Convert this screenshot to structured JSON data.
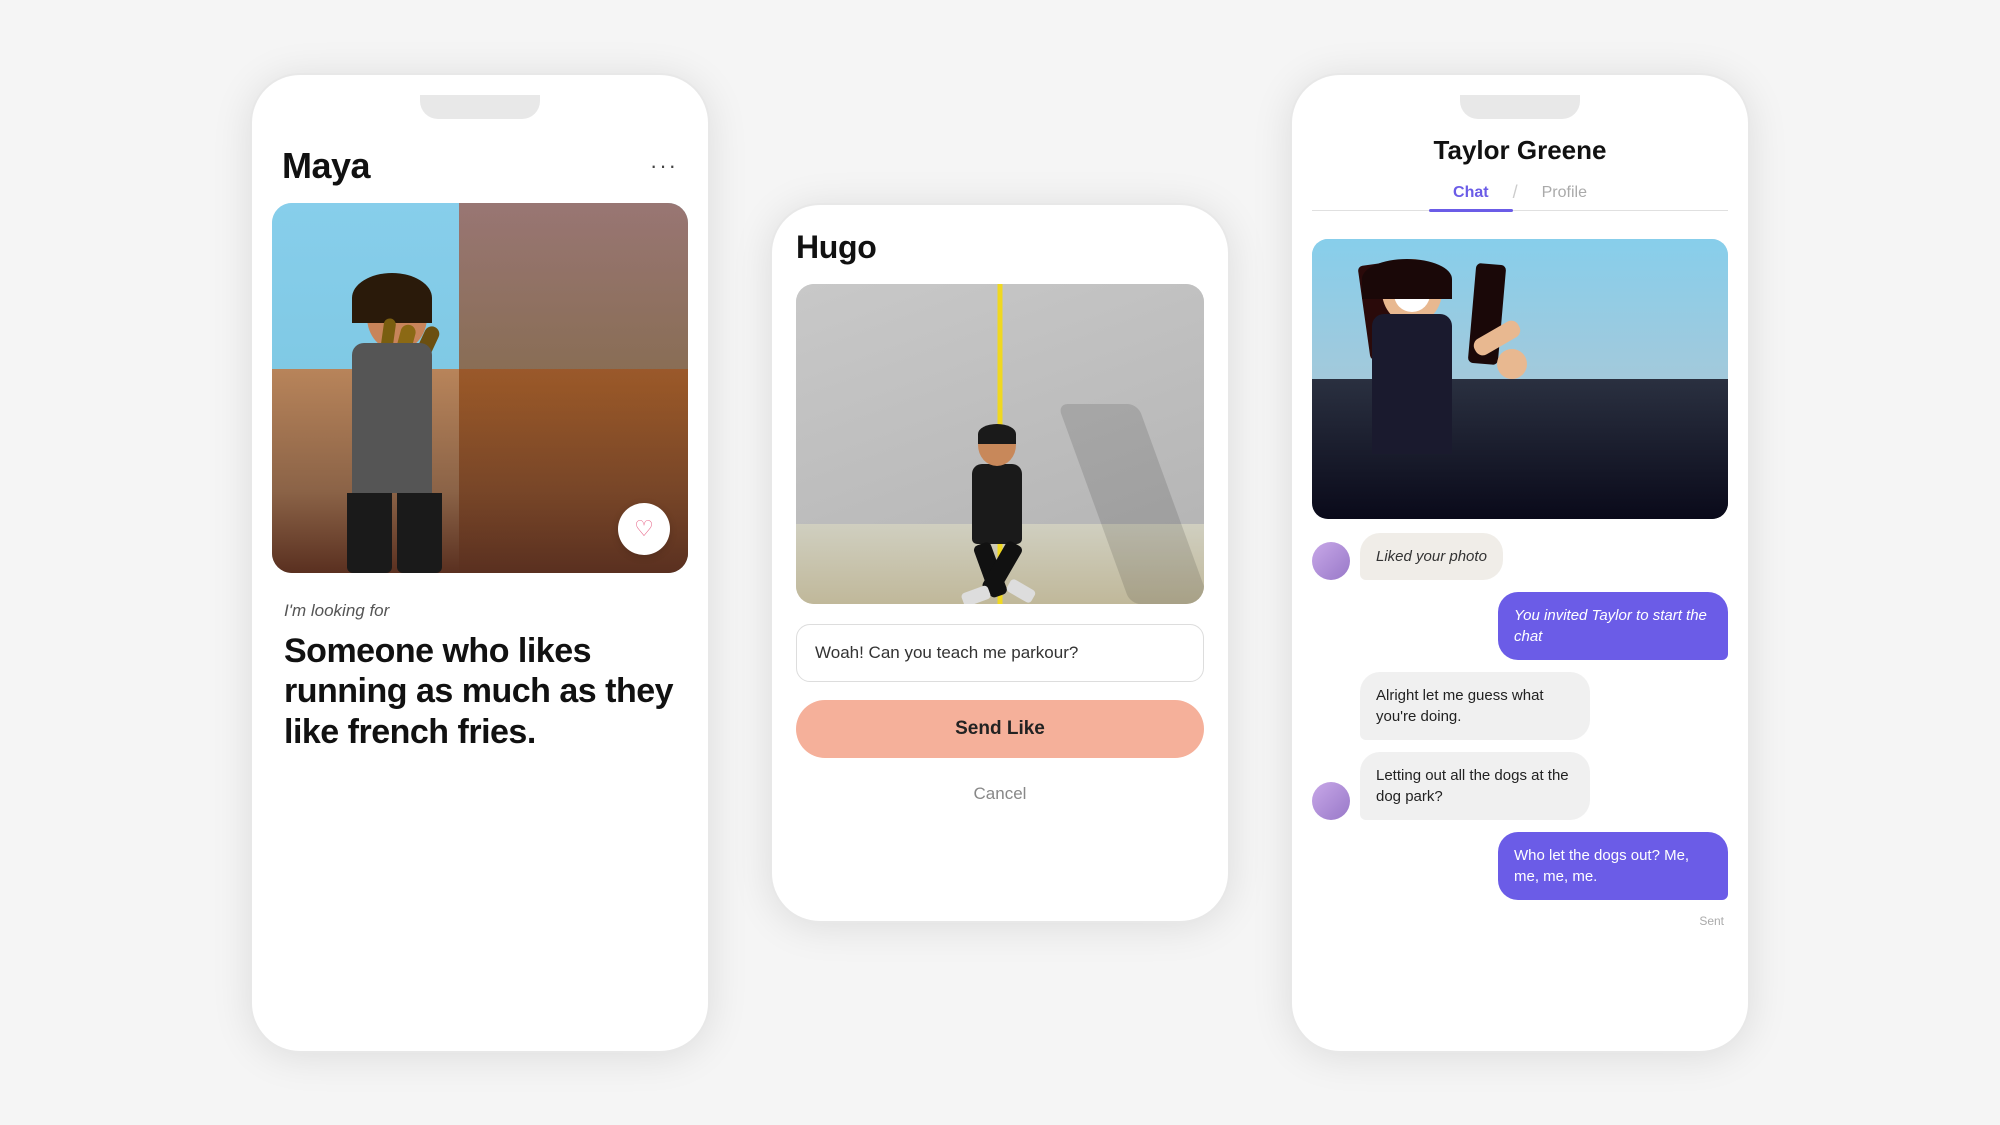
{
  "screen1": {
    "name": "Maya",
    "dots": "···",
    "bio_label": "I'm looking for",
    "bio_text": "Someone who likes running as much as they like french fries."
  },
  "screen2": {
    "title": "Hugo",
    "message_placeholder": "Woah! Can you teach me parkour?",
    "send_like_label": "Send Like",
    "cancel_label": "Cancel"
  },
  "screen3": {
    "title": "Taylor Greene",
    "tab_chat": "Chat",
    "tab_divider": "/",
    "tab_profile": "Profile",
    "messages": [
      {
        "type": "incoming",
        "text": "Liked your photo",
        "has_avatar": true
      },
      {
        "type": "system",
        "text": "You invited Taylor to start the chat"
      },
      {
        "type": "incoming",
        "text": "Alright let me guess what you're doing.",
        "has_avatar": false
      },
      {
        "type": "incoming",
        "text": "Letting out all the dogs at the dog park?",
        "has_avatar": true
      },
      {
        "type": "outgoing",
        "text": "Who let the dogs out? Me, me, me, me."
      }
    ],
    "sent_label": "Sent"
  },
  "colors": {
    "accent": "#6b5ce7",
    "like_bg": "#f5b09a",
    "system_bubble": "#6b5ce7"
  }
}
